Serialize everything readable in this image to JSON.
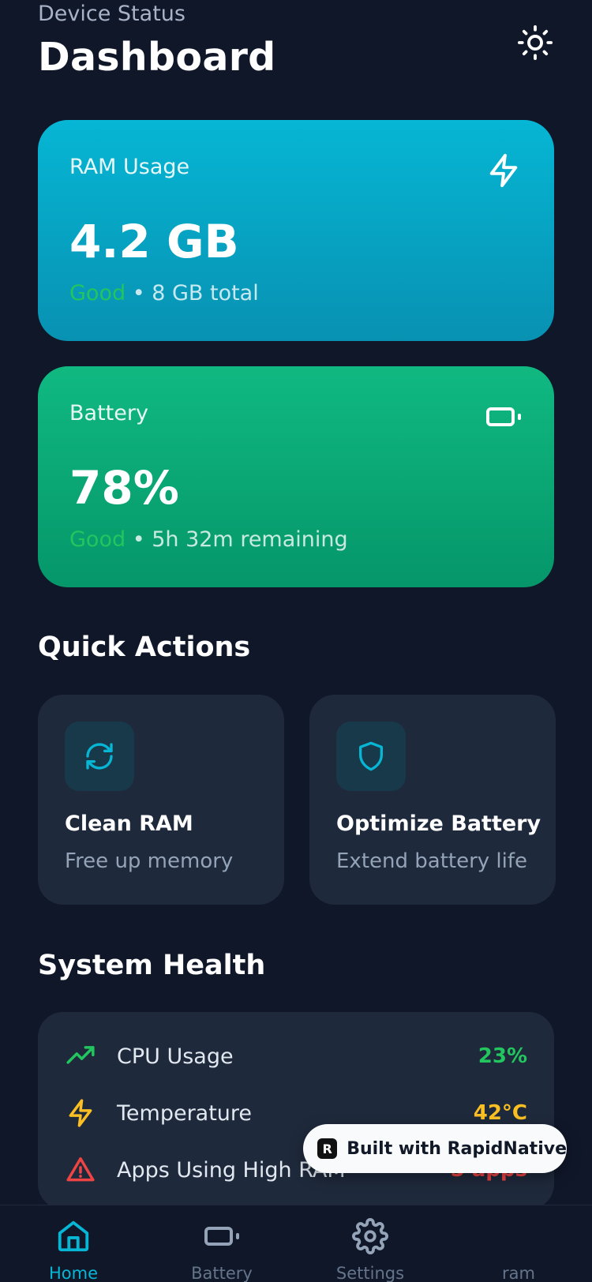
{
  "header": {
    "subtitle": "Device Status",
    "title": "Dashboard",
    "theme_icon": "sun-icon"
  },
  "cards": {
    "ram": {
      "label": "RAM Usage",
      "value": "4.2 GB",
      "status": "Good",
      "detail": " • 8 GB total",
      "icon": "lightning-icon",
      "color_top": "#06b6d4",
      "color_bottom": "#0891b2"
    },
    "battery": {
      "label": "Battery",
      "value": "78%",
      "status": "Good",
      "detail": " • 5h 32m remaining",
      "icon": "battery-icon",
      "color_top": "#10b981",
      "color_bottom": "#059669"
    },
    "status_color": "#22c55e"
  },
  "quick_actions": {
    "title": "Quick Actions",
    "items": [
      {
        "title": "Clean RAM",
        "desc": "Free up memory",
        "icon": "refresh-icon"
      },
      {
        "title": "Optimize Battery",
        "desc": "Extend battery life",
        "icon": "shield-icon"
      }
    ]
  },
  "system_health": {
    "title": "System Health",
    "rows": [
      {
        "label": "CPU Usage",
        "value": "23%",
        "icon": "trending-up-icon",
        "color": "#22c55e"
      },
      {
        "label": "Temperature",
        "value": "42°C",
        "icon": "lightning-icon",
        "color": "#fbbf24"
      },
      {
        "label": "Apps Using High RAM",
        "value": "5 apps",
        "icon": "warning-icon",
        "color": "#ef4444"
      }
    ]
  },
  "badge": {
    "text": "Built with RapidNative",
    "logo": "R"
  },
  "nav": {
    "items": [
      {
        "label": "Home",
        "icon": "home-icon",
        "active": true
      },
      {
        "label": "Battery",
        "icon": "battery-icon",
        "active": false
      },
      {
        "label": "Settings",
        "icon": "gear-icon",
        "active": false
      },
      {
        "label": "ram",
        "icon": "",
        "active": false
      }
    ],
    "active_color": "#06b6d4",
    "inactive_color": "#64748b"
  }
}
